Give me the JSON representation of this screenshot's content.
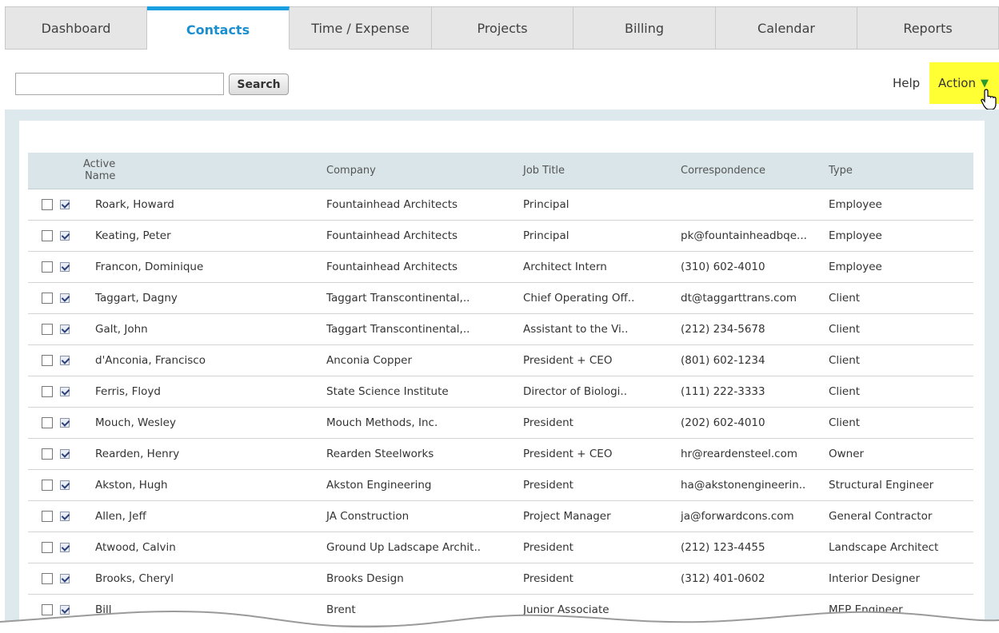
{
  "tabs": [
    {
      "label": "Dashboard",
      "active": false
    },
    {
      "label": "Contacts",
      "active": true
    },
    {
      "label": "Time / Expense",
      "active": false
    },
    {
      "label": "Projects",
      "active": false
    },
    {
      "label": "Billing",
      "active": false
    },
    {
      "label": "Calendar",
      "active": false
    },
    {
      "label": "Reports",
      "active": false
    }
  ],
  "toolbar": {
    "search_value": "",
    "search_label": "Search",
    "help_label": "Help",
    "action_label": "Action",
    "action_icon": "triangle-down-icon"
  },
  "table": {
    "columns": [
      "Active",
      "Name",
      "Company",
      "Job Title",
      "Correspondence",
      "Type"
    ],
    "rows": [
      {
        "selected": false,
        "active": true,
        "name": "Roark, Howard",
        "company": "Fountainhead Architects",
        "title": "Principal",
        "corr": "",
        "type": "Employee"
      },
      {
        "selected": false,
        "active": true,
        "name": "Keating, Peter",
        "company": "Fountainhead Architects",
        "title": "Principal",
        "corr": "pk@fountainheadbqe...",
        "type": "Employee"
      },
      {
        "selected": false,
        "active": true,
        "name": "Francon, Dominique",
        "company": "Fountainhead Architects",
        "title": "Architect Intern",
        "corr": "(310) 602-4010",
        "type": "Employee"
      },
      {
        "selected": false,
        "active": true,
        "name": "Taggart, Dagny",
        "company": "Taggart Transcontinental,..",
        "title": "Chief Operating Off..",
        "corr": "dt@taggarttrans.com",
        "type": "Client"
      },
      {
        "selected": false,
        "active": true,
        "name": "Galt, John",
        "company": "Taggart Transcontinental,..",
        "title": "Assistant to the Vi..",
        "corr": "(212) 234-5678",
        "type": "Client"
      },
      {
        "selected": false,
        "active": true,
        "name": "d'Anconia, Francisco",
        "company": "Anconia Copper",
        "title": "President + CEO",
        "corr": "(801) 602-1234",
        "type": "Client"
      },
      {
        "selected": false,
        "active": true,
        "name": "Ferris, Floyd",
        "company": "State Science Institute",
        "title": "Director of Biologi..",
        "corr": "(111) 222-3333",
        "type": "Client"
      },
      {
        "selected": false,
        "active": true,
        "name": "Mouch, Wesley",
        "company": "Mouch Methods, Inc.",
        "title": "President",
        "corr": "(202) 602-4010",
        "type": "Client"
      },
      {
        "selected": false,
        "active": true,
        "name": "Rearden, Henry",
        "company": "Rearden Steelworks",
        "title": "President + CEO",
        "corr": "hr@reardensteel.com",
        "type": "Owner"
      },
      {
        "selected": false,
        "active": true,
        "name": "Akston, Hugh",
        "company": "Akston Engineering",
        "title": "President",
        "corr": "ha@akstonengineerin..",
        "type": "Structural Engineer"
      },
      {
        "selected": false,
        "active": true,
        "name": "Allen, Jeff",
        "company": "JA Construction",
        "title": "Project Manager",
        "corr": "ja@forwardcons.com",
        "type": "General Contractor"
      },
      {
        "selected": false,
        "active": true,
        "name": "Atwood, Calvin",
        "company": "Ground Up Ladscape Archit..",
        "title": "President",
        "corr": "(212) 123-4455",
        "type": "Landscape Architect"
      },
      {
        "selected": false,
        "active": true,
        "name": "Brooks, Cheryl",
        "company": "Brooks Design",
        "title": "President",
        "corr": "(312) 401-0602",
        "type": "Interior Designer"
      },
      {
        "selected": false,
        "active": true,
        "name": "Bill",
        "company": "Brent",
        "title": "Junior Associate",
        "corr": "",
        "type": "MEP Engineer"
      }
    ]
  }
}
